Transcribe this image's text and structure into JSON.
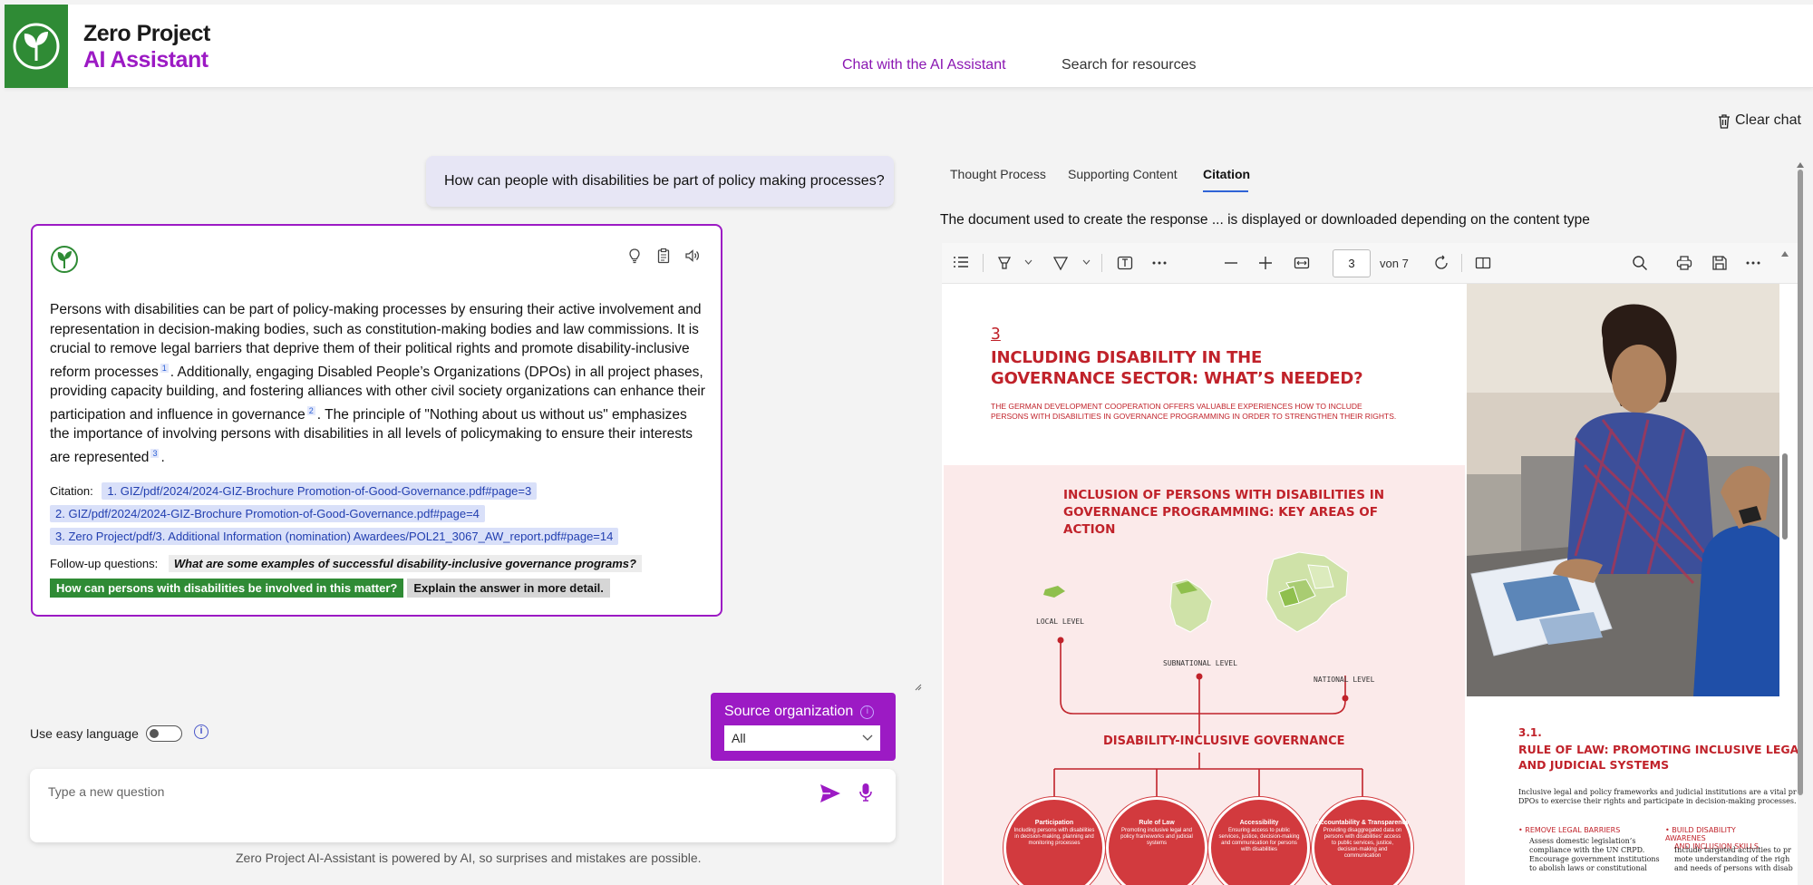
{
  "header": {
    "brand_line1": "Zero Project",
    "brand_line2": "AI Assistant",
    "nav_chat": "Chat with the AI Assistant",
    "nav_search": "Search for resources"
  },
  "clear_chat": "Clear chat",
  "user_question": "How can people with disabilities be part of policy making processes?",
  "answer": {
    "p1": "Persons with disabilities can be part of policy-making processes by ensuring their active involvement and representation in decision-making bodies, such as constitution-making bodies and law commissions. It is crucial to remove legal barriers that deprive them of their political rights and promote disability-inclusive reform processes",
    "ref1": "1",
    "p2": ". Additionally, engaging Disabled People’s Organizations (DPOs) in all project phases, providing capacity building, and fostering alliances with other civil society organizations can enhance their participation and influence in governance",
    "ref2": "2",
    "p3": ". The principle of \"Nothing about us without us\" emphasizes the importance of involving persons with disabilities in all levels of policymaking to ensure their interests are represented",
    "ref3": "3",
    "p4": ".",
    "citation_label": "Citation:",
    "citations": [
      "1. GIZ/pdf/2024/2024-GIZ-Brochure Promotion-of-Good-Governance.pdf#page=3",
      "2. GIZ/pdf/2024/2024-GIZ-Brochure Promotion-of-Good-Governance.pdf#page=4",
      "3. Zero Project/pdf/3. Additional Information (nomination) Awardees/POL21_3067_AW_report.pdf#page=14"
    ],
    "followup_label": "Follow-up questions:",
    "followups": [
      "What are some examples of successful disability-inclusive governance programs?",
      "How can persons with disabilities be involved in this matter?",
      "Explain the answer in more detail."
    ]
  },
  "easy_language_label": "Use easy language",
  "info_glyph": "i",
  "source_org": {
    "label": "Source organization",
    "selected": "All"
  },
  "question_input": {
    "placeholder": "Type a new question"
  },
  "disclaimer": "Zero Project AI-Assistant is powered by AI, so surprises and mistakes are possible.",
  "right_panel": {
    "tabs": [
      "Thought Process",
      "Supporting Content",
      "Citation"
    ],
    "active_tab": "Citation",
    "description": "The document used to create the response ... is displayed or downloaded depending on the content type"
  },
  "pdf_viewer": {
    "current_page": "3",
    "page_of": "von 7"
  },
  "pdf_page": {
    "section_num": "3",
    "title": "INCLUDING DISABILITY IN THE GOVERNANCE SECTOR: WHAT’S NEEDED?",
    "subtitle": "THE GERMAN DEVELOPMENT COOPERATION OFFERS VALUABLE EXPERIENCES HOW TO INCLUDE PERSONS WITH DISABILITIES IN GOVERNANCE PROGRAMMING IN ORDER TO STRENGTHEN THEIR RIGHTS.",
    "inclusion_title": "INCLUSION OF PERSONS WITH DISABILITIES IN GOVERNANCE PROGRAMMING: KEY AREAS OF ACTION",
    "local_level": "LOCAL LEVEL",
    "subnational_level": "SUBNATIONAL LEVEL",
    "national_level": "NATIONAL LEVEL",
    "dig": "DISABILITY-INCLUSIVE GOVERNANCE",
    "circles": [
      {
        "title": "Participation",
        "desc": "Including persons with disabilities in decision-making, planning and monitoring processes"
      },
      {
        "title": "Rule of Law",
        "desc": "Promoting inclusive legal and policy frameworks and judicial systems"
      },
      {
        "title": "Accessibility",
        "desc": "Ensuring access to public services, justice, decision-making and communication for persons with disabilities"
      },
      {
        "title": "Accountability & Transparency",
        "desc": "Providing disaggregated data on persons with disabilities' access to public services, justice, decision-making and communication"
      }
    ],
    "rol_num": "3.1.",
    "rol_title_1": "RULE OF LAW: PROMOTING INCLUSIVE LEGAL AI",
    "rol_title_2": "AND JUDICIAL SYSTEMS",
    "rol_text_1": "Inclusive legal and policy frameworks and judicial institutions are a vital pr",
    "rol_text_2": "DPOs to exercise their rights and participate in decision-making processes.",
    "bullet1_title": "•  REMOVE LEGAL BARRIERS",
    "bullet1_text_1": "Assess domestic legislation’s",
    "bullet1_text_2": "compliance with the UN CRPD.",
    "bullet1_text_3": "Encourage government institutions",
    "bullet1_text_4": "to abolish laws or constitutional",
    "bullet2_title": "•  BUILD DISABILITY AWARENES",
    "bullet2_title_2": "AND INCLUSION SKILLS",
    "bullet2_text_1": "Include targeted activities to pr",
    "bullet2_text_2": "mote understanding of the righ",
    "bullet2_text_3": "and needs of persons with disab"
  },
  "colors": {
    "brand_green": "#2f8b35",
    "brand_purple": "#9c1ac4",
    "pdf_red": "#c0222a"
  }
}
